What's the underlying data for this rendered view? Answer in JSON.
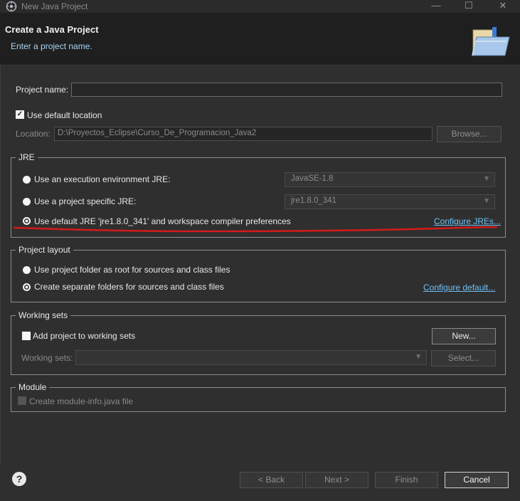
{
  "window": {
    "title": "New Java Project",
    "minimize": "—",
    "maximize": "☐",
    "close": "✕"
  },
  "header": {
    "title": "Create a Java Project",
    "subtitle": "Enter a project name."
  },
  "project": {
    "name_label": "Project name:",
    "name_value": ""
  },
  "location": {
    "use_default_label": "Use default location",
    "use_default_checked": true,
    "label": "Location:",
    "value": "D:\\Proyectos_Eclipse\\Curso_De_Programacion_Java2",
    "browse_label": "Browse..."
  },
  "jre": {
    "title": "JRE",
    "options": [
      {
        "label": "Use an execution environment JRE:",
        "select": "JavaSE-1.8"
      },
      {
        "label": "Use a project specific JRE:",
        "select": "jre1.8.0_341"
      },
      {
        "label": "Use default JRE 'jre1.8.0_341' and workspace compiler preferences",
        "selected": true
      }
    ],
    "configure_link": "Configure JREs..."
  },
  "layout": {
    "title": "Project layout",
    "options": [
      {
        "label": "Use project folder as root for sources and class files"
      },
      {
        "label": "Create separate folders for sources and class files",
        "selected": true
      }
    ],
    "configure_link": "Configure default..."
  },
  "working_sets": {
    "title": "Working sets",
    "add_label": "Add project to working sets",
    "new_label": "New...",
    "sets_label": "Working sets:",
    "sets_value": "",
    "select_label": "Select..."
  },
  "module": {
    "title": "Module",
    "create_label": "Create module-info.java file"
  },
  "footer": {
    "help": "?",
    "back": "< Back",
    "next": "Next >",
    "finish": "Finish",
    "cancel": "Cancel"
  },
  "colors": {
    "annotation_underline": "#d41a1a",
    "link": "#6ec1f5"
  }
}
